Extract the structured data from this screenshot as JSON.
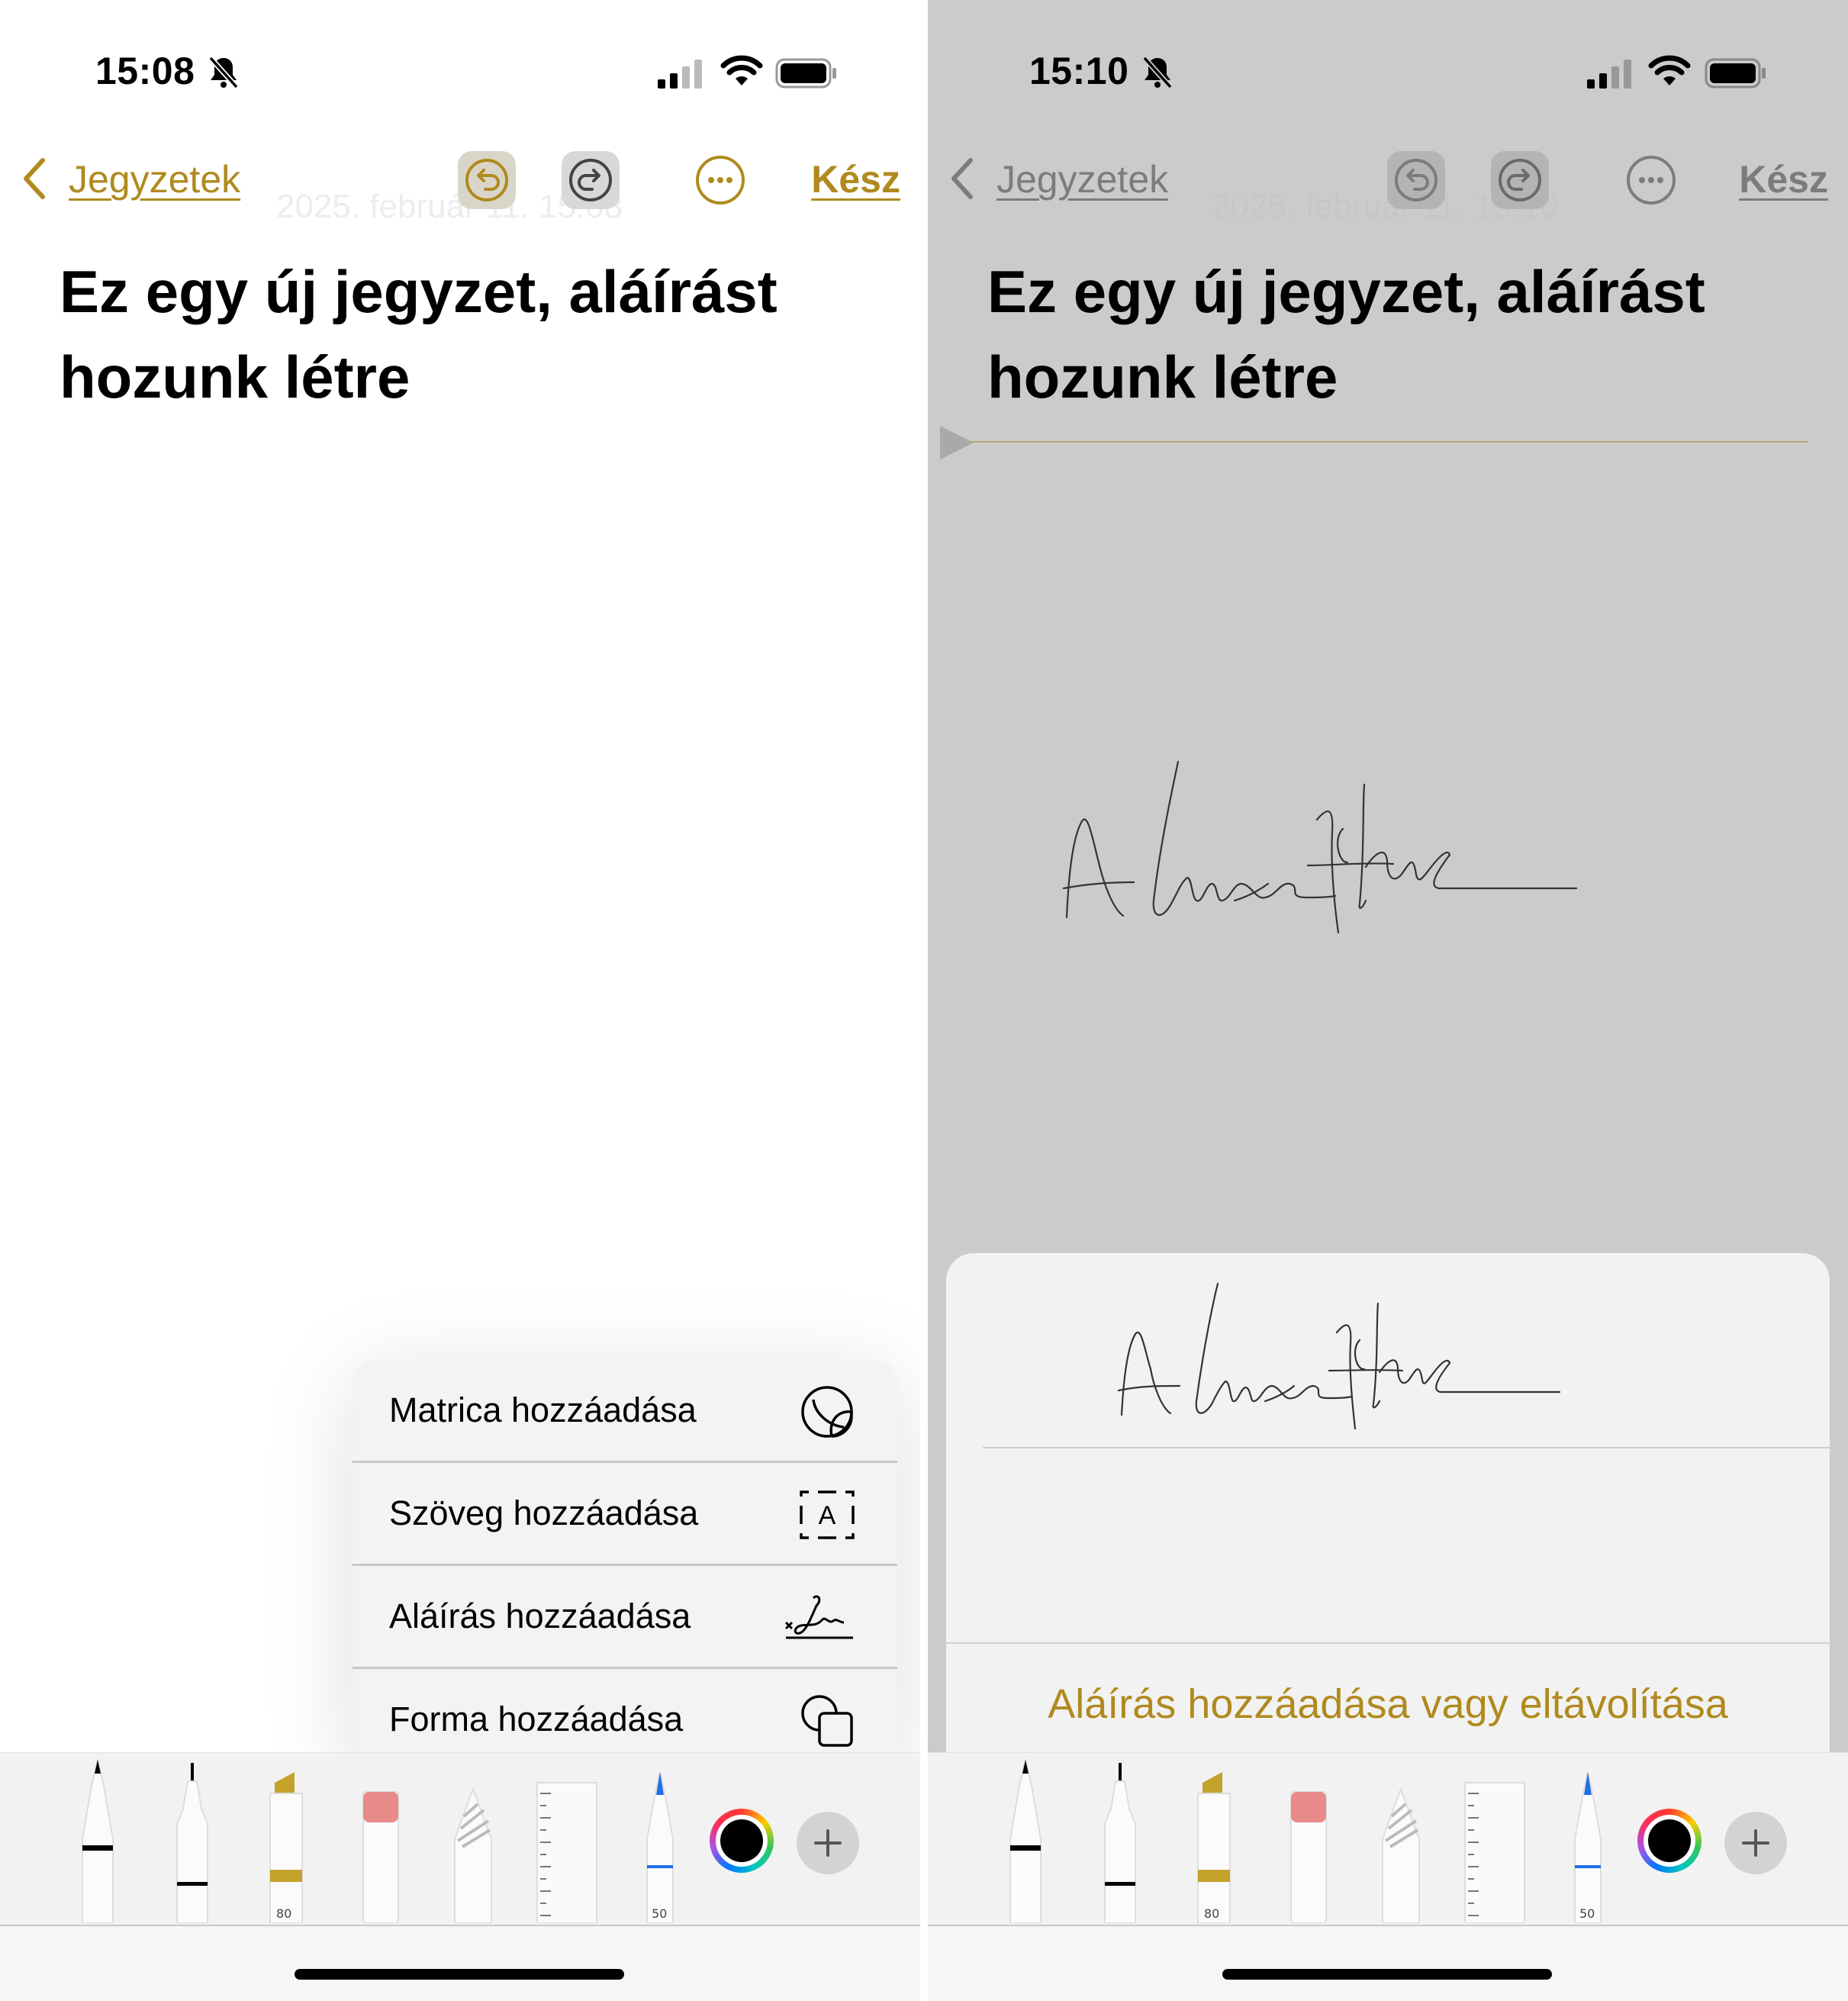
{
  "left": {
    "status": {
      "time": "15:08"
    },
    "nav": {
      "back_label": "Jegyzetek",
      "done_label": "Kész"
    },
    "note": {
      "title": "Ez egy új jegyzet, aláírást hozunk létre"
    },
    "faded_date": "2025. február 11. 15:08",
    "menu": {
      "items": [
        {
          "label": "Matrica hozzáadása",
          "icon": "sticker-icon"
        },
        {
          "label": "Szöveg hozzáadása",
          "icon": "text-box-icon"
        },
        {
          "label": "Aláírás hozzáadása",
          "icon": "signature-icon"
        },
        {
          "label": "Forma hozzáadása",
          "icon": "shapes-icon"
        }
      ]
    },
    "tools": {
      "marker_width": "80",
      "pen_width": "50"
    }
  },
  "right": {
    "status": {
      "time": "15:10"
    },
    "nav": {
      "back_label": "Jegyzetek",
      "done_label": "Kész"
    },
    "note": {
      "title": "Ez egy új jegyzet, aláírást hozunk létre"
    },
    "faded_date": "2025. február 11. 15:10",
    "sheet": {
      "action_label": "Aláírás hozzáadása vagy eltávolítása"
    },
    "tools": {
      "marker_width": "80",
      "pen_width": "50"
    }
  },
  "colors": {
    "accent": "#b08a1e",
    "dim_background": "#cbcbcb",
    "selected_ink": "#000000"
  }
}
